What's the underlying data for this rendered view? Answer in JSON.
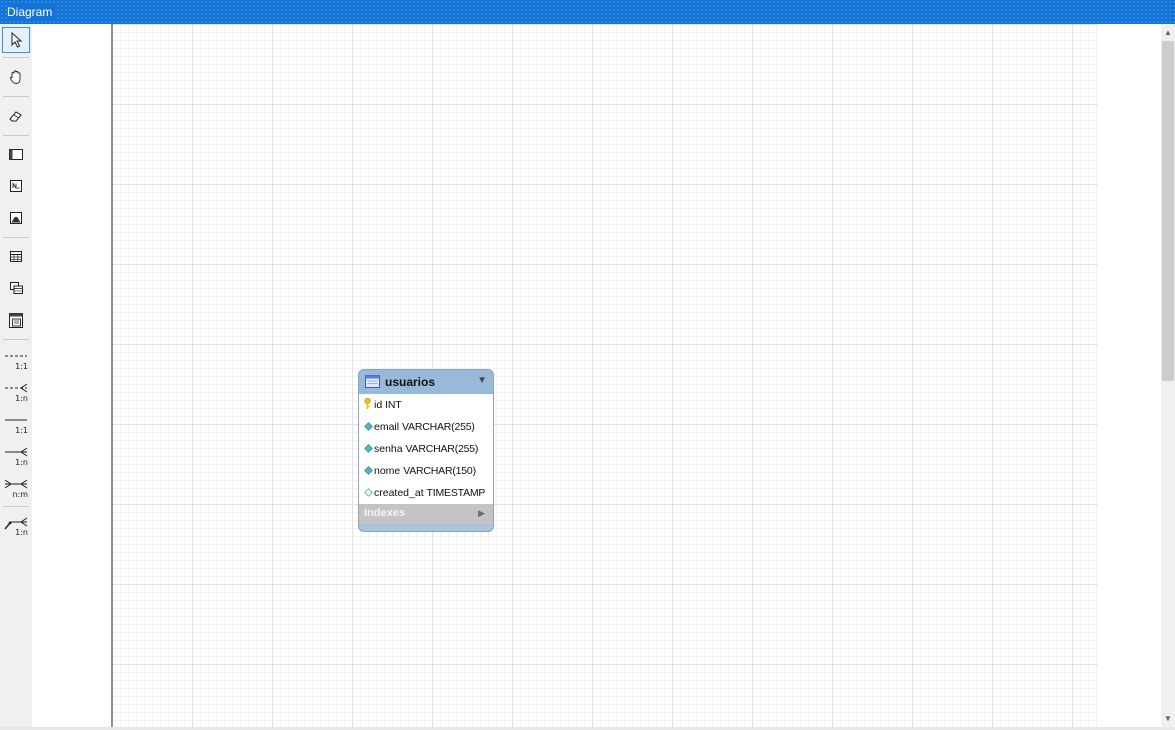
{
  "window": {
    "title": "Diagram"
  },
  "toolbar": {
    "tools": [
      {
        "name": "pointer-tool",
        "icon": "arrow-pointer-icon",
        "selected": true
      },
      {
        "name": "hand-tool",
        "icon": "hand-icon"
      },
      {
        "name": "eraser-tool",
        "icon": "eraser-icon"
      },
      {
        "name": "layer-tool",
        "icon": "layer-icon"
      },
      {
        "name": "note-tool",
        "icon": "note-icon"
      },
      {
        "name": "image-tool",
        "icon": "image-icon"
      },
      {
        "name": "table-tool",
        "icon": "table-icon"
      },
      {
        "name": "view-tool",
        "icon": "view-icon"
      },
      {
        "name": "routine-group-tool",
        "icon": "routine-group-icon"
      }
    ],
    "relationships": [
      {
        "name": "relationship-1-1-non-identifying",
        "label": "1:1"
      },
      {
        "name": "relationship-1-n-non-identifying",
        "label": "1:n"
      },
      {
        "name": "relationship-1-1-identifying",
        "label": "1:1"
      },
      {
        "name": "relationship-1-n-identifying",
        "label": "1:n"
      },
      {
        "name": "relationship-n-m-identifying",
        "label": "n:m"
      },
      {
        "name": "relationship-1-n-existing-columns",
        "label": "1:n"
      }
    ]
  },
  "entity": {
    "name": "usuarios",
    "columns": [
      {
        "name": "id",
        "type": "INT",
        "icon": "primary-key-icon"
      },
      {
        "name": "email",
        "type": "VARCHAR(255)",
        "icon": "not-null-column-icon"
      },
      {
        "name": "senha",
        "type": "VARCHAR(255)",
        "icon": "not-null-column-icon"
      },
      {
        "name": "nome",
        "type": "VARCHAR(150)",
        "icon": "not-null-column-icon"
      },
      {
        "name": "created_at",
        "type": "TIMESTAMP",
        "icon": "nullable-column-icon"
      }
    ],
    "indexes_label": "Indexes"
  },
  "colors": {
    "titlebar": "#1473d6",
    "entity_header": "#98b9d9",
    "key_icon": "#e8c21a",
    "column_icon": "#4fb7c4"
  }
}
